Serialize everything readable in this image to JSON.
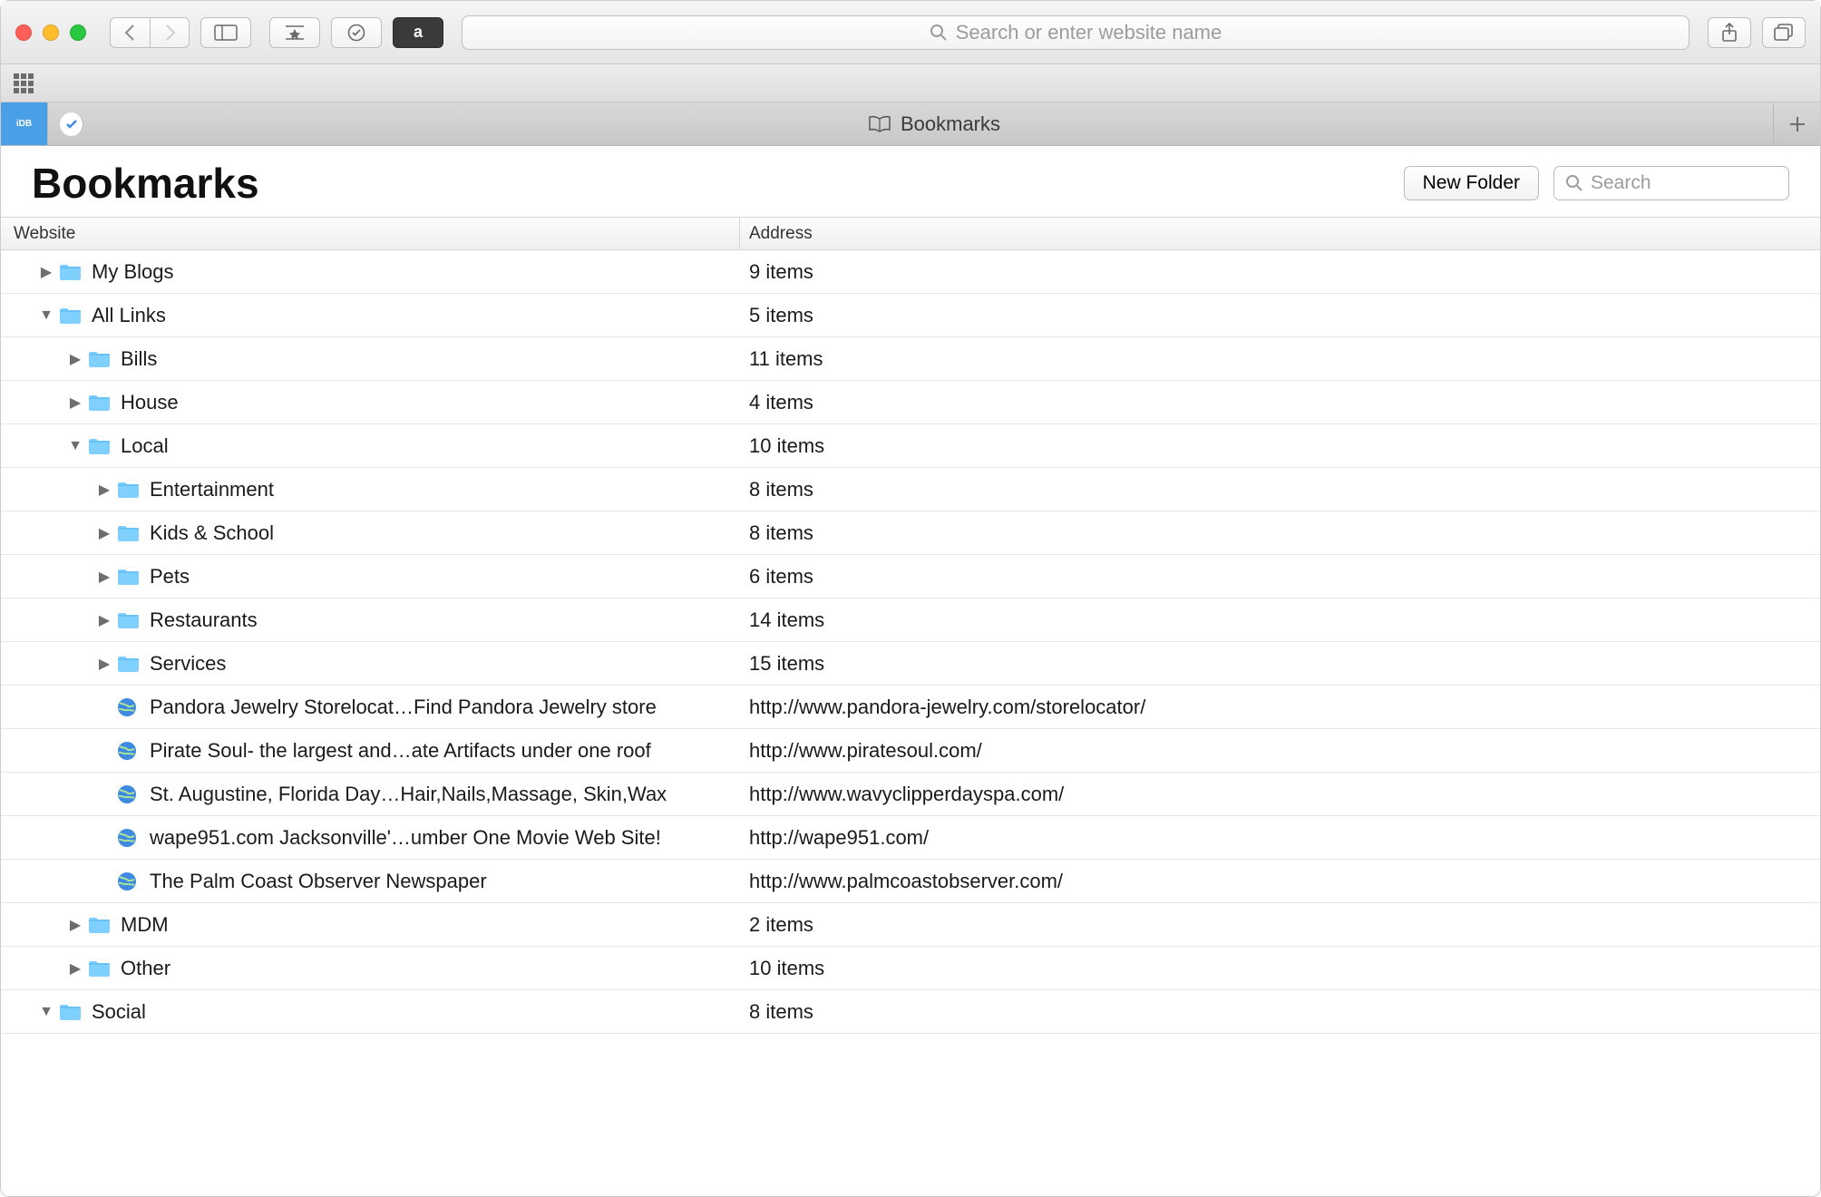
{
  "toolbar": {
    "url_placeholder": "Search or enter website name",
    "amazon_label": "a"
  },
  "tabbar": {
    "pin1_label": "iDB",
    "active_tab_label": "Bookmarks"
  },
  "header": {
    "title": "Bookmarks",
    "new_folder_label": "New Folder",
    "search_placeholder": "Search"
  },
  "columns": {
    "website": "Website",
    "address": "Address"
  },
  "rows": [
    {
      "type": "folder",
      "name": "My Blogs",
      "addr": "9 items",
      "indent": 0,
      "expanded": false
    },
    {
      "type": "folder",
      "name": "All Links",
      "addr": "5 items",
      "indent": 0,
      "expanded": true
    },
    {
      "type": "folder",
      "name": "Bills",
      "addr": "11 items",
      "indent": 1,
      "expanded": false
    },
    {
      "type": "folder",
      "name": "House",
      "addr": "4 items",
      "indent": 1,
      "expanded": false
    },
    {
      "type": "folder",
      "name": "Local",
      "addr": "10 items",
      "indent": 1,
      "expanded": true
    },
    {
      "type": "folder",
      "name": "Entertainment",
      "addr": "8 items",
      "indent": 2,
      "expanded": false
    },
    {
      "type": "folder",
      "name": "Kids & School",
      "addr": "8 items",
      "indent": 2,
      "expanded": false
    },
    {
      "type": "folder",
      "name": "Pets",
      "addr": "6 items",
      "indent": 2,
      "expanded": false
    },
    {
      "type": "folder",
      "name": "Restaurants",
      "addr": "14 items",
      "indent": 2,
      "expanded": false
    },
    {
      "type": "folder",
      "name": "Services",
      "addr": "15 items",
      "indent": 2,
      "expanded": false
    },
    {
      "type": "link",
      "hasDisc": false,
      "name": "Pandora Jewelry Storelocat…Find Pandora Jewelry store",
      "addr": "http://www.pandora-jewelry.com/storelocator/",
      "indent": 2
    },
    {
      "type": "link",
      "hasDisc": false,
      "name": "Pirate Soul- the largest and…ate Artifacts under one roof",
      "addr": "http://www.piratesoul.com/",
      "indent": 2
    },
    {
      "type": "link",
      "hasDisc": false,
      "name": "St. Augustine, Florida Day…Hair,Nails,Massage, Skin,Wax",
      "addr": "http://www.wavyclipperdayspa.com/",
      "indent": 2
    },
    {
      "type": "link",
      "hasDisc": false,
      "name": "wape951.com Jacksonville'…umber One Movie Web Site!",
      "addr": "http://wape951.com/",
      "indent": 2
    },
    {
      "type": "link",
      "hasDisc": false,
      "name": "The Palm Coast Observer Newspaper",
      "addr": "http://www.palmcoastobserver.com/",
      "indent": 2
    },
    {
      "type": "folder",
      "name": "MDM",
      "addr": "2 items",
      "indent": 1,
      "expanded": false
    },
    {
      "type": "folder",
      "name": "Other",
      "addr": "10 items",
      "indent": 1,
      "expanded": false
    },
    {
      "type": "folder",
      "name": "Social",
      "addr": "8 items",
      "indent": 0,
      "expanded": true
    }
  ]
}
